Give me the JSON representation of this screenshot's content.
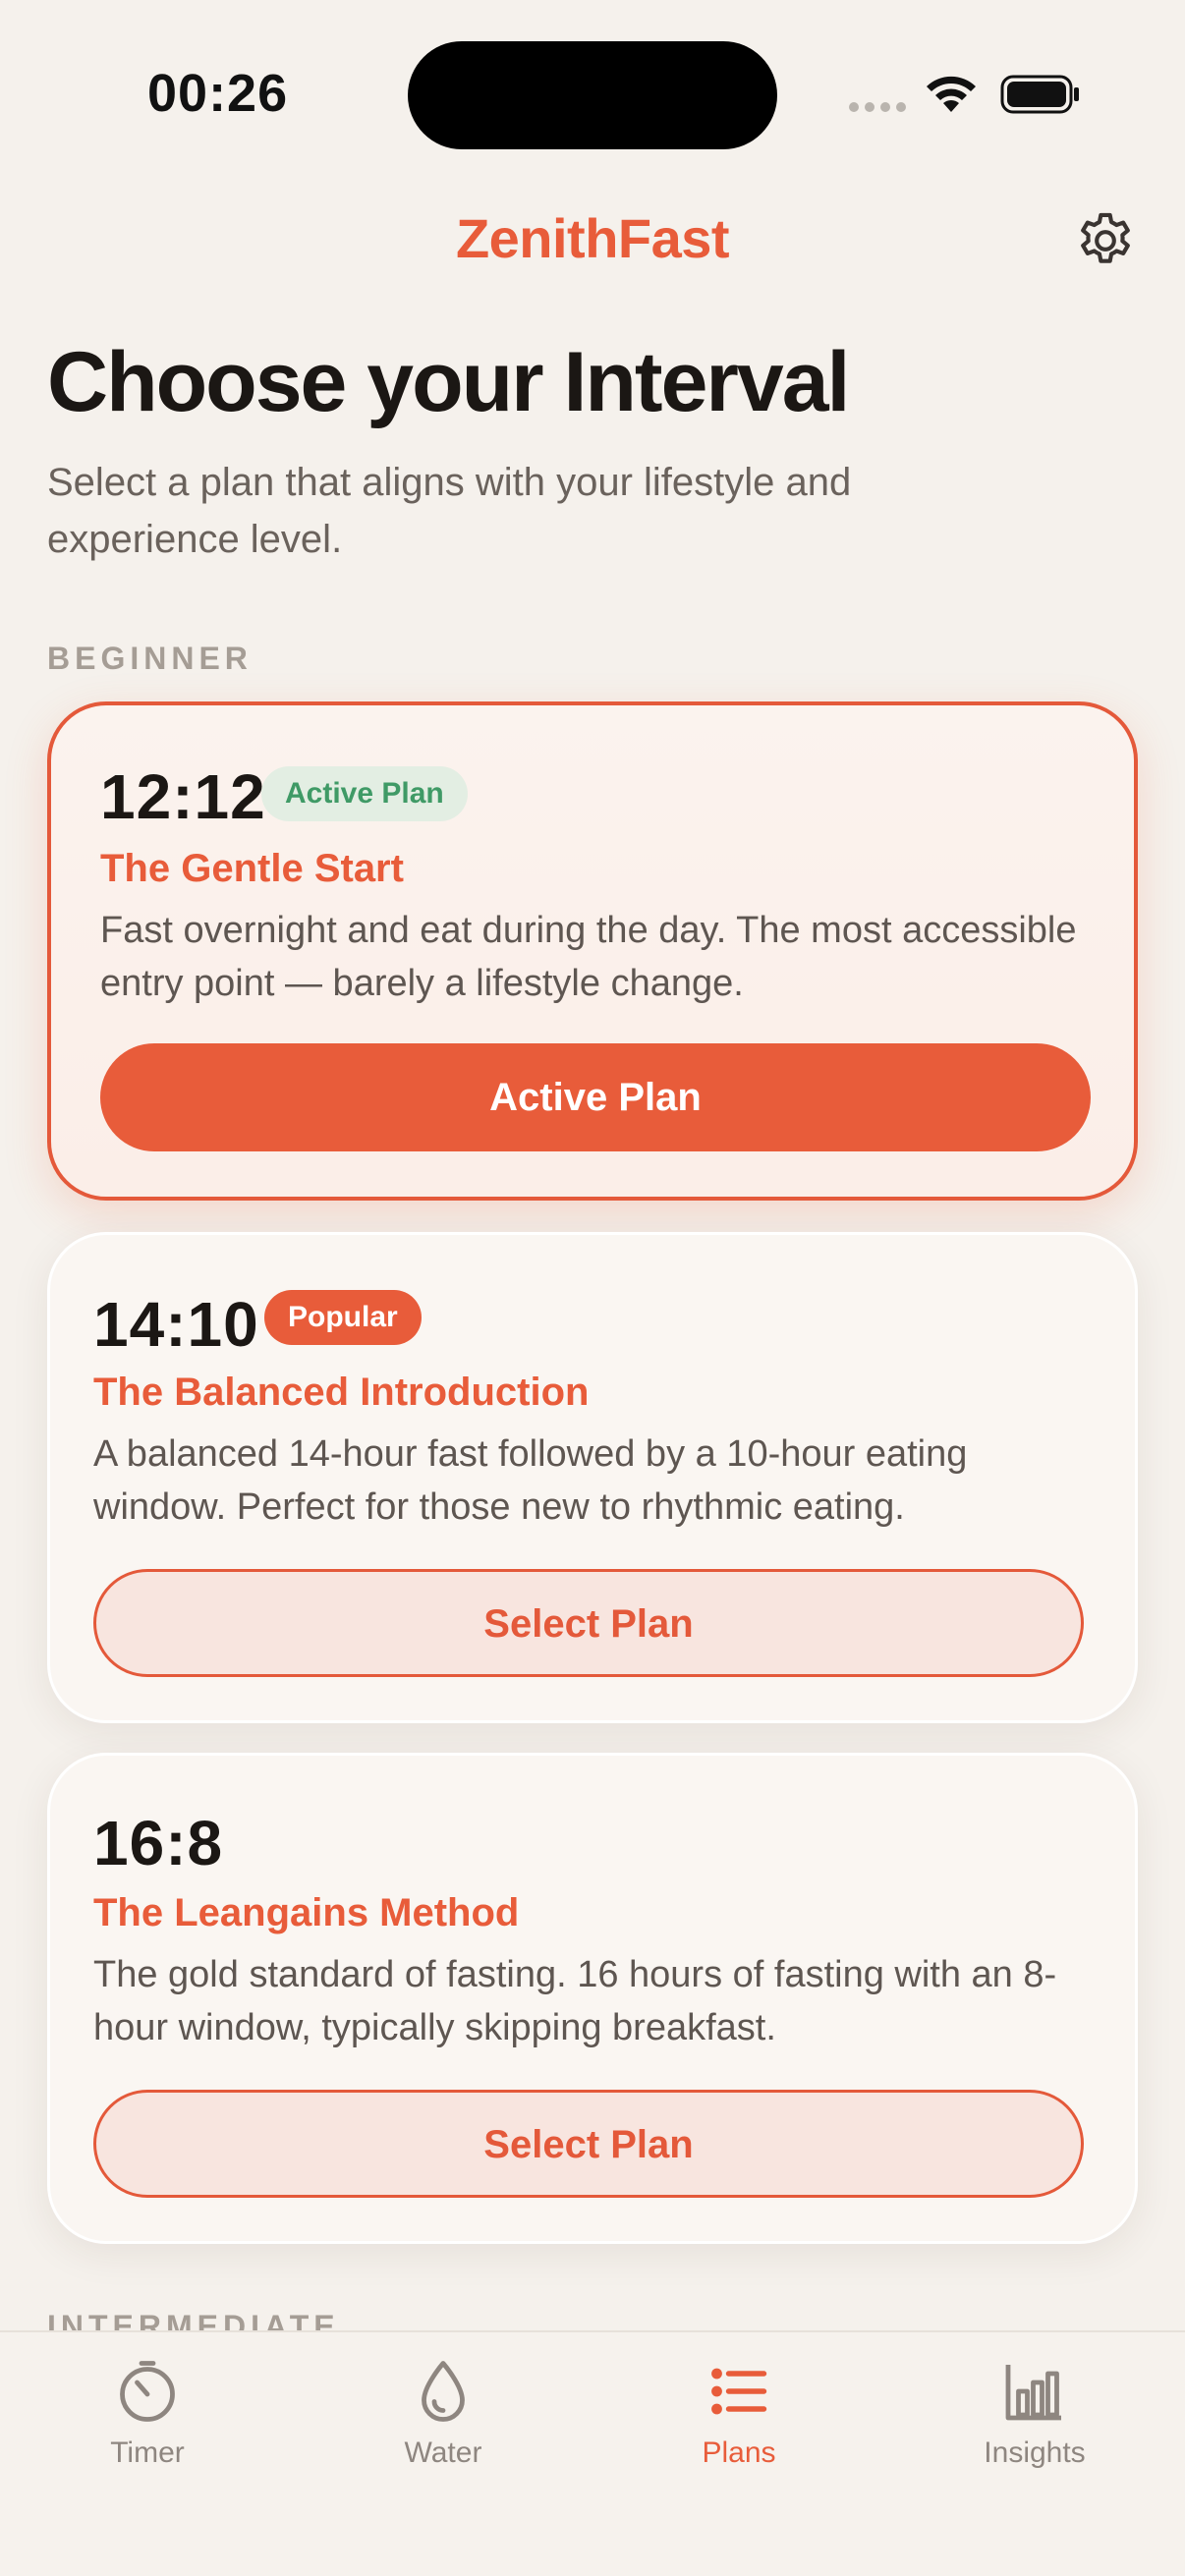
{
  "status": {
    "time": "00:26"
  },
  "header": {
    "brand": "ZenithFast"
  },
  "page": {
    "title": "Choose your Interval",
    "subtitle": "Select a plan that aligns with your lifestyle and experience level."
  },
  "sections": {
    "beginner": "BEGINNER",
    "intermediate": "INTERMEDIATE"
  },
  "plans": [
    {
      "ratio": "12:12",
      "badge": "Active Plan",
      "name": "The Gentle Start",
      "description": "Fast overnight and eat during the day. The most accessible entry point — barely a lifestyle change.",
      "button": "Active Plan"
    },
    {
      "ratio": "14:10",
      "badge": "Popular",
      "name": "The Balanced Introduction",
      "description": "A balanced 14-hour fast followed by a 10-hour eating window. Perfect for those new to rhythmic eating.",
      "button": "Select Plan"
    },
    {
      "ratio": "16:8",
      "name": "The Leangains Method",
      "description": "The gold standard of fasting. 16 hours of fasting with an 8-hour window, typically skipping breakfast.",
      "button": "Select Plan"
    }
  ],
  "tabs": [
    {
      "label": "Timer",
      "icon": "timer-icon"
    },
    {
      "label": "Water",
      "icon": "water-drop-icon"
    },
    {
      "label": "Plans",
      "icon": "list-icon",
      "active": true
    },
    {
      "label": "Insights",
      "icon": "bar-chart-icon"
    }
  ],
  "colors": {
    "accent": "#e85c3a",
    "background": "#f5f1ec",
    "success": "#3f9a66"
  }
}
